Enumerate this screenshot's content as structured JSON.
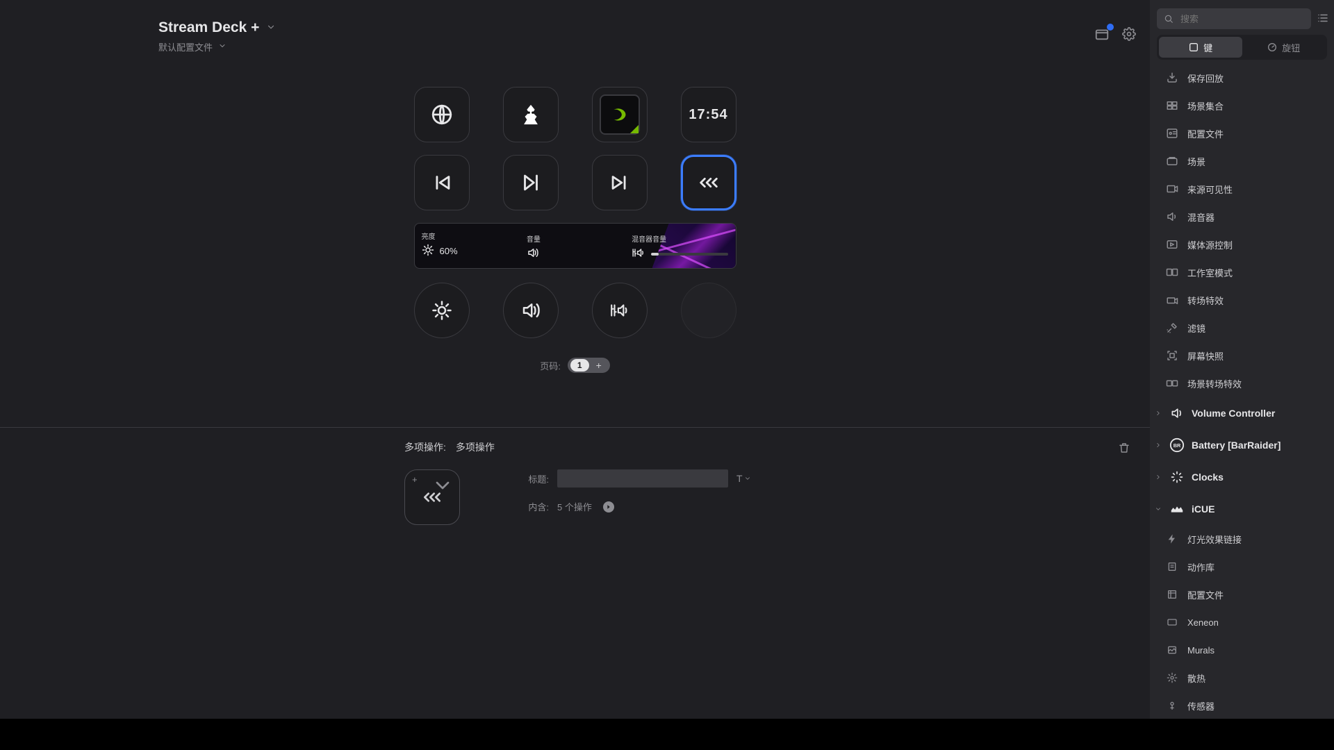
{
  "header": {
    "title": "Stream Deck +",
    "profile": "默认配置文件"
  },
  "keys": {
    "clock": "17:54"
  },
  "touchbar": {
    "brightness": {
      "label": "亮度",
      "value": "60%",
      "fill_pct": 60
    },
    "volume": {
      "label": "音量"
    },
    "mixer": {
      "label": "混音器音量"
    }
  },
  "pager": {
    "label": "页码:",
    "current": "1"
  },
  "props": {
    "type_label": "多项操作:",
    "type_value": "多项操作",
    "title_label": "标题:",
    "title_value": "",
    "contains_label": "内含:",
    "contains_value": "5 个操作"
  },
  "sidebar": {
    "search_placeholder": "搜索",
    "tab_keys": "键",
    "tab_dials": "旋钮",
    "flat_items": [
      "保存回放",
      "场景集合",
      "配置文件",
      "场景",
      "来源可见性",
      "混音器",
      "媒体源控制",
      "工作室模式",
      "转场特效",
      "滤镜",
      "屏幕快照",
      "场景转场特效"
    ],
    "cats": [
      {
        "name": "Volume Controller",
        "open": false
      },
      {
        "name": "Battery [BarRaider]",
        "open": false
      },
      {
        "name": "Clocks",
        "open": false
      },
      {
        "name": "iCUE",
        "open": true,
        "children": [
          "灯光效果链接",
          "动作库",
          "配置文件",
          "Xeneon",
          "Murals",
          "散热",
          "传感器"
        ]
      }
    ]
  }
}
